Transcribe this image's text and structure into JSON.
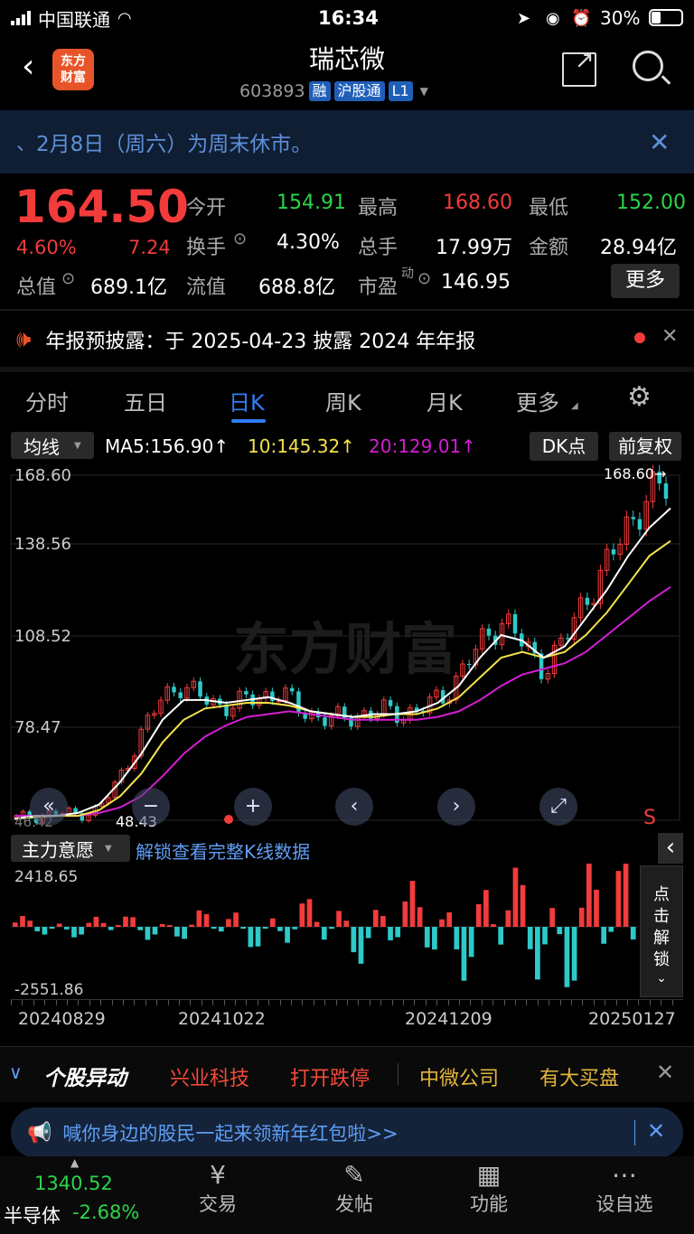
{
  "status_bar": {
    "carrier": "中国联通",
    "time": "16:34",
    "battery": "30%"
  },
  "header": {
    "app_logo": "东方\n财富",
    "stock_name": "瑞芯微",
    "stock_code": "603893",
    "badges": [
      "融",
      "沪股通",
      "L1"
    ]
  },
  "notice": {
    "text": "2月8日（周六）为周末休市。"
  },
  "quote": {
    "price": "164.50",
    "change_pct": "4.60%",
    "change": "7.24",
    "open_label": "今开",
    "open": "154.91",
    "high_label": "最高",
    "high": "168.60",
    "low_label": "最低",
    "low": "152.00",
    "turnover_label": "换手",
    "turnover": "4.30%",
    "volume_label": "总手",
    "volume": "17.99万",
    "amount_label": "金额",
    "amount": "28.94亿",
    "mktcap_label": "总值",
    "mktcap": "689.1亿",
    "float_label": "流值",
    "float": "688.8亿",
    "pe_label": "市盈",
    "pe_sup": "动",
    "pe": "146.95",
    "more_button": "更多"
  },
  "announcement": {
    "text": "年报预披露：于 2025-04-23 披露 2024 年年报"
  },
  "tabs": [
    "分时",
    "五日",
    "日K",
    "周K",
    "月K",
    "更多"
  ],
  "active_tab": 2,
  "ma_bar": {
    "select": "均线",
    "ma5": "MA5:156.90↑",
    "ma10": "10:145.32↑",
    "ma20": "20:129.01↑",
    "dk_button": "DK点",
    "adjust_button": "前复权"
  },
  "kline_labels": {
    "y_ticks": [
      "168.60",
      "138.56",
      "108.52",
      "78.47"
    ],
    "max_marker": "168.60→",
    "min_marker": "48.43",
    "left_value": "46.42",
    "s_marker": "S",
    "watermark": "东方财富"
  },
  "indicator": {
    "select": "主力意愿",
    "unlock_link": "解锁查看完整K线数据",
    "top_value": "2418.65",
    "bottom_value": "-2551.86",
    "side_unlock": [
      "点",
      "击",
      "解",
      "锁"
    ]
  },
  "date_axis": [
    "20240829",
    "20241022",
    "20241209",
    "20250127"
  ],
  "ticker_strip": {
    "title": "个股异动",
    "items": [
      {
        "text": "兴业科技",
        "color": "#f24b3b"
      },
      {
        "text": "打开跌停",
        "color": "#f24b3b"
      },
      {
        "text": "中微公司",
        "color": "#e3b53b"
      },
      {
        "text": "有大买盘",
        "color": "#e3b53b"
      }
    ]
  },
  "promo": {
    "text": "喊你身边的股民一起来领新年红包啦>>"
  },
  "bottom_nav": {
    "index_value": "1340.52",
    "index_name": "半导体",
    "index_change": "-2.68%",
    "items": [
      "交易",
      "发帖",
      "功能",
      "设自选"
    ]
  },
  "colors": {
    "up": "#f23b3b",
    "down": "#2bd44a",
    "ma5": "#ffffff",
    "ma10": "#f2e24b",
    "ma20": "#d41ed4",
    "neg_bar": "#2ec9c9",
    "accent": "#2f7df5"
  },
  "chart_data": {
    "type": "candlestick",
    "ylim": [
      46.42,
      168.6
    ],
    "close_sampled": [
      47,
      48,
      49,
      48.43,
      50,
      60,
      75,
      88,
      95,
      90,
      87,
      88,
      90,
      92,
      85,
      83,
      82,
      84,
      85,
      84,
      86,
      90,
      100,
      110,
      118,
      108,
      100,
      110,
      125,
      135,
      150,
      160,
      164.5
    ],
    "ma5_sampled": [
      47,
      48,
      48,
      49,
      52,
      60,
      70,
      82,
      89,
      89,
      88,
      89,
      90,
      88,
      85,
      84,
      83,
      84,
      84,
      85,
      88,
      94,
      104,
      112,
      110,
      104,
      108,
      118,
      128,
      140,
      150,
      156.9
    ],
    "ma10_sampled": [
      47,
      47.5,
      48,
      48,
      50,
      55,
      63,
      74,
      82,
      86,
      87,
      88,
      88,
      87,
      85,
      84,
      83,
      83,
      84,
      84,
      86,
      90,
      97,
      104,
      106,
      104,
      106,
      112,
      120,
      130,
      140,
      145.32
    ],
    "ma20_sampled": [
      48,
      48,
      48,
      48,
      49,
      51,
      55,
      62,
      70,
      76,
      80,
      83,
      84,
      85,
      84,
      83,
      82,
      82,
      82,
      82,
      83,
      85,
      89,
      94,
      98,
      100,
      102,
      106,
      112,
      118,
      124,
      129.01
    ]
  }
}
